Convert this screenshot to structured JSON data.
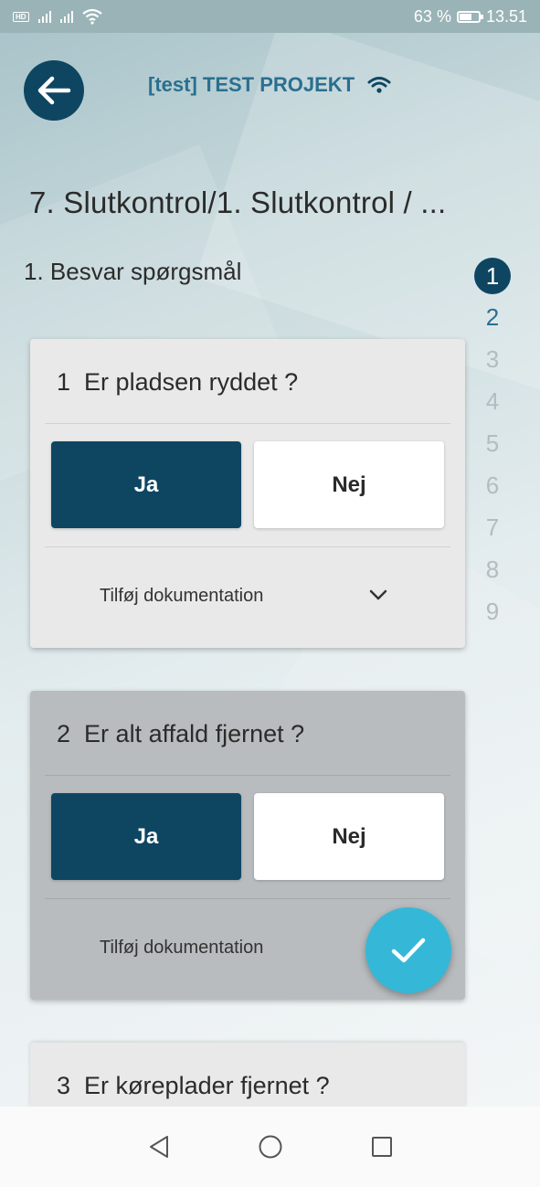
{
  "status_bar": {
    "network_badge": "HD",
    "battery_percent": "63 %",
    "time": "13.51"
  },
  "header": {
    "project_title": "[test] TEST PROJEKT"
  },
  "page_title": "7. Slutkontrol/1. Slutkontrol / ...",
  "section_title": "1. Besvar spørgsmål",
  "stepper": {
    "steps": [
      "1",
      "2",
      "3",
      "4",
      "5",
      "6",
      "7",
      "8",
      "9"
    ],
    "active": "1"
  },
  "questions": [
    {
      "number": "1",
      "text": "Er pladsen ryddet ?",
      "yes_label": "Ja",
      "no_label": "Nej",
      "doc_label": "Tilføj dokumentation"
    },
    {
      "number": "2",
      "text": "Er alt affald fjernet ?",
      "yes_label": "Ja",
      "no_label": "Nej",
      "doc_label": "Tilføj dokumentation"
    },
    {
      "number": "3",
      "text": "Er køreplader fjernet ?"
    }
  ],
  "colors": {
    "primary": "#0e4662",
    "accent": "#35b8d8",
    "title_link": "#2a6f8f"
  },
  "icons": {
    "back": "arrow-left-icon",
    "wifi": "wifi-icon",
    "expand": "chevron-down-icon",
    "confirm": "checkmark-icon"
  }
}
